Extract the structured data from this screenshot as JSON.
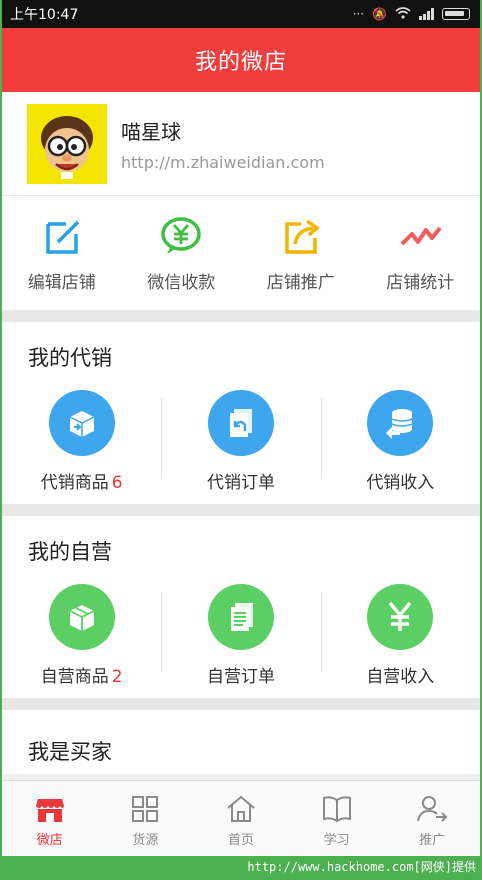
{
  "status_bar": {
    "time": "上午10:47"
  },
  "header": {
    "title": "我的微店"
  },
  "profile": {
    "shop_name": "喵星球",
    "shop_url": "http://m.zhaiweidian.com",
    "avatar_icon": "cartoon-boy-avatar"
  },
  "quick_actions": [
    {
      "label": "编辑店铺",
      "icon": "edit-icon",
      "color": "#2aa0e8"
    },
    {
      "label": "微信收款",
      "icon": "yuan-bubble-icon",
      "color": "#3fbf3f"
    },
    {
      "label": "店铺推广",
      "icon": "share-icon",
      "color": "#f4b400"
    },
    {
      "label": "店铺统计",
      "icon": "trend-icon",
      "color": "#f05a5a"
    }
  ],
  "consign": {
    "title": "我的代销",
    "items": [
      {
        "label": "代销商品",
        "count": "6",
        "icon": "box-arrow-icon"
      },
      {
        "label": "代销订单",
        "count": "",
        "icon": "return-doc-icon"
      },
      {
        "label": "代销收入",
        "count": "",
        "icon": "coins-icon"
      }
    ]
  },
  "self_run": {
    "title": "我的自营",
    "items": [
      {
        "label": "自营商品",
        "count": "2",
        "icon": "box-icon"
      },
      {
        "label": "自营订单",
        "count": "",
        "icon": "document-icon"
      },
      {
        "label": "自营收入",
        "count": "",
        "icon": "yuan-icon"
      }
    ]
  },
  "buyer": {
    "title": "我是买家"
  },
  "tabs": [
    {
      "label": "微店",
      "icon": "store-icon",
      "active": true
    },
    {
      "label": "货源",
      "icon": "grid-icon",
      "active": false
    },
    {
      "label": "首页",
      "icon": "home-icon",
      "active": false
    },
    {
      "label": "学习",
      "icon": "book-icon",
      "active": false
    },
    {
      "label": "推广",
      "icon": "user-share-icon",
      "active": false
    }
  ],
  "watermark": "http://www.hackhome.com[网侠]提供",
  "colors": {
    "accent": "#f23d3d",
    "blue": "#3ea6ec",
    "green": "#5ccf64",
    "count_red": "#e8383b"
  }
}
